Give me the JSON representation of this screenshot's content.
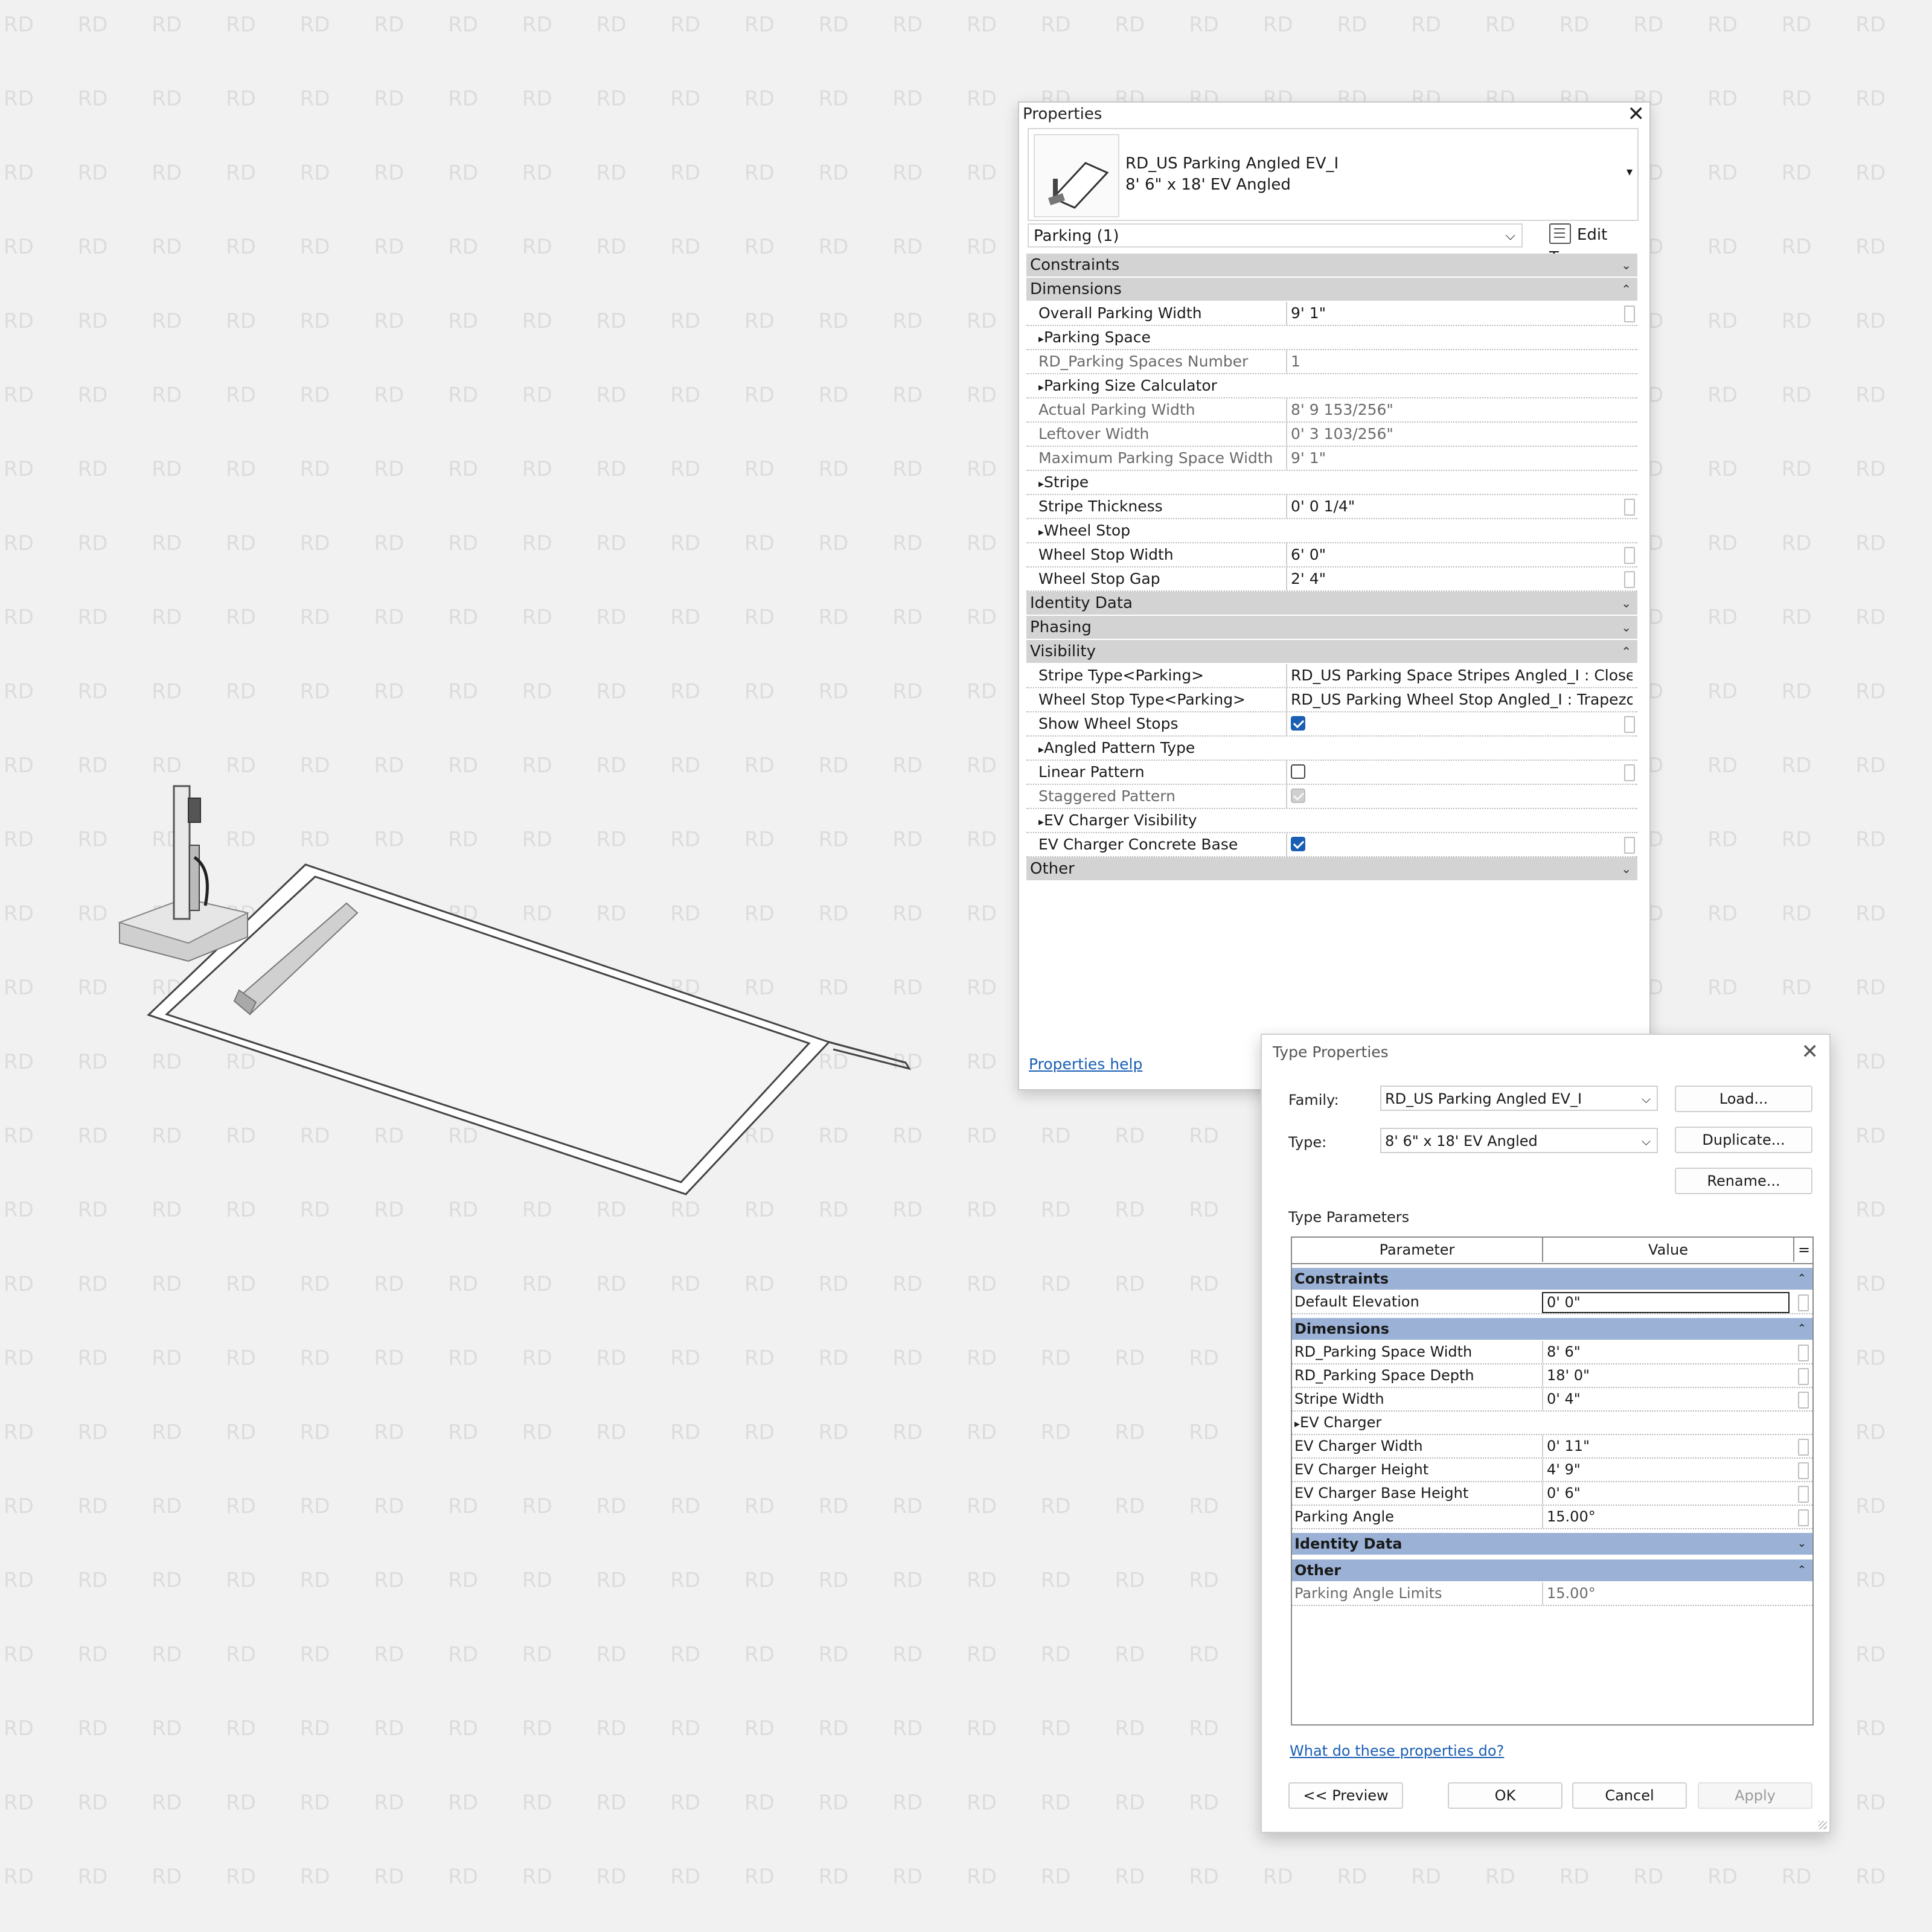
{
  "background": {
    "watermark_text": "RD",
    "color": "#f1f1f1"
  },
  "properties": {
    "title": "Properties",
    "type_selector": {
      "family": "RD_US Parking Angled EV_I",
      "type": "8' 6\" x 18' EV Angled"
    },
    "instance_filter": "Parking (1)",
    "edit_type_label": "Edit Type",
    "groups": [
      {
        "label": "Constraints",
        "expanded": false,
        "rows": []
      },
      {
        "label": "Dimensions",
        "expanded": true,
        "rows": [
          {
            "name": "Overall Parking Width",
            "value": "9'  1\"",
            "kind": "edit"
          },
          {
            "name": "Parking Space",
            "value": "",
            "kind": "sub"
          },
          {
            "name": "RD_Parking Spaces Number",
            "value": "1",
            "kind": "ro"
          },
          {
            "name": "Parking Size Calculator",
            "value": "",
            "kind": "sub"
          },
          {
            "name": "Actual Parking Width",
            "value": "8'  9 153/256\"",
            "kind": "ro"
          },
          {
            "name": "Leftover Width",
            "value": "0'  3 103/256\"",
            "kind": "ro"
          },
          {
            "name": "Maximum Parking Space Width",
            "value": "9'  1\"",
            "kind": "ro"
          },
          {
            "name": "Stripe",
            "value": "",
            "kind": "sub"
          },
          {
            "name": "Stripe Thickness",
            "value": "0'  0 1/4\"",
            "kind": "edit"
          },
          {
            "name": "Wheel Stop",
            "value": "",
            "kind": "sub"
          },
          {
            "name": "Wheel Stop Width",
            "value": "6'  0\"",
            "kind": "edit"
          },
          {
            "name": "Wheel Stop Gap",
            "value": "2'  4\"",
            "kind": "edit"
          }
        ]
      },
      {
        "label": "Identity Data",
        "expanded": false,
        "rows": []
      },
      {
        "label": "Phasing",
        "expanded": false,
        "rows": []
      },
      {
        "label": "Visibility",
        "expanded": true,
        "rows": [
          {
            "name": "Stripe Type<Parking>",
            "value": "RD_US Parking Space Stripes Angled_I : Closed",
            "kind": "plain"
          },
          {
            "name": "Wheel Stop Type<Parking>",
            "value": "RD_US Parking Wheel Stop Angled_I : Trapezoidal",
            "kind": "plain"
          },
          {
            "name": "Show Wheel Stops",
            "value": "",
            "kind": "check",
            "checked": true
          },
          {
            "name": "Angled Pattern Type",
            "value": "",
            "kind": "sub"
          },
          {
            "name": "Linear Pattern",
            "value": "",
            "kind": "check",
            "checked": false
          },
          {
            "name": "Staggered Pattern",
            "value": "",
            "kind": "checkro",
            "checked": true
          },
          {
            "name": "EV Charger Visibility",
            "value": "",
            "kind": "sub"
          },
          {
            "name": "EV Charger Concrete Base",
            "value": "",
            "kind": "check",
            "checked": true
          }
        ]
      },
      {
        "label": "Other",
        "expanded": false,
        "rows": []
      }
    ],
    "help_link": "Properties help"
  },
  "type_properties": {
    "title": "Type Properties",
    "family_label": "Family:",
    "family_value": "RD_US Parking Angled EV_I",
    "type_label": "Type:",
    "type_value": "8' 6\" x 18' EV Angled",
    "load_button": "Load...",
    "duplicate_button": "Duplicate...",
    "rename_button": "Rename...",
    "section_label": "Type Parameters",
    "col_parameter": "Parameter",
    "col_value": "Value",
    "col_eq": "=",
    "groups": [
      {
        "label": "Constraints",
        "expanded": true,
        "rows": [
          {
            "name": "Default Elevation",
            "value": "0'  0\"",
            "kind": "active"
          }
        ]
      },
      {
        "label": "Dimensions",
        "expanded": true,
        "rows": [
          {
            "name": "RD_Parking Space Width",
            "value": "8'  6\"",
            "kind": "edit"
          },
          {
            "name": "RD_Parking Space Depth",
            "value": "18'  0\"",
            "kind": "edit"
          },
          {
            "name": "Stripe Width",
            "value": "0'  4\"",
            "kind": "edit"
          },
          {
            "name": "EV Charger",
            "value": "",
            "kind": "sub"
          },
          {
            "name": "EV Charger Width",
            "value": "0'  11\"",
            "kind": "edit"
          },
          {
            "name": "EV Charger Height",
            "value": "4'  9\"",
            "kind": "edit"
          },
          {
            "name": "EV Charger Base Height",
            "value": "0'  6\"",
            "kind": "edit"
          },
          {
            "name": "Parking Angle",
            "value": "15.00°",
            "kind": "edit"
          }
        ]
      },
      {
        "label": "Identity Data",
        "expanded": false,
        "rows": []
      },
      {
        "label": "Other",
        "expanded": true,
        "rows": [
          {
            "name": "Parking Angle Limits",
            "value": "15.00°",
            "kind": "ro"
          }
        ]
      }
    ],
    "help_link": "What do these properties do?",
    "preview_button": "<< Preview",
    "ok_button": "OK",
    "cancel_button": "Cancel",
    "apply_button": "Apply"
  }
}
